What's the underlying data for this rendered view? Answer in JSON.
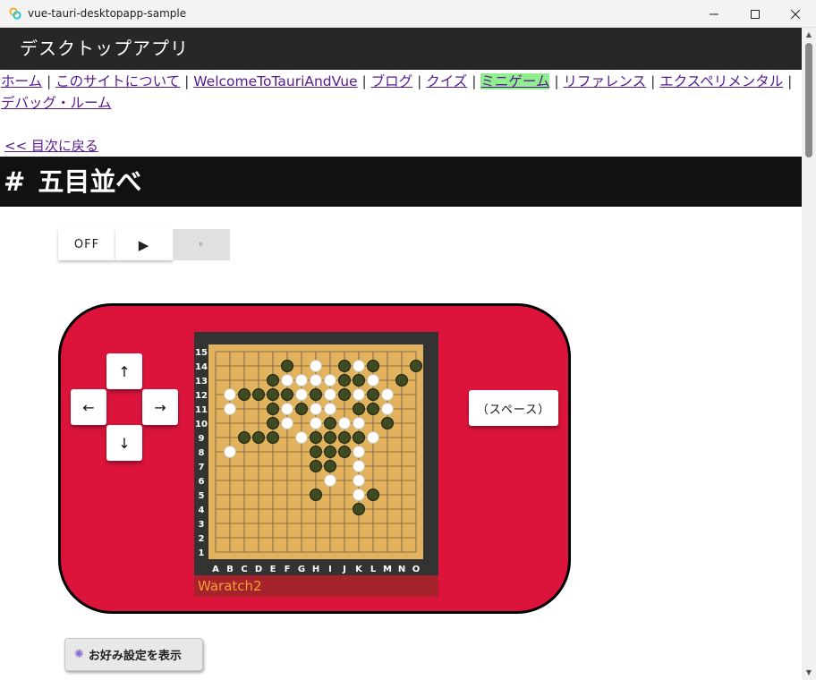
{
  "window": {
    "title": "vue-tauri-desktopapp-sample",
    "minimize_glyph": "—",
    "maximize_glyph": "☐",
    "close_glyph": "✕"
  },
  "header": {
    "title": "デスクトップアプリ"
  },
  "nav": {
    "items": [
      {
        "label": "ホーム",
        "active": false
      },
      {
        "label": "このサイトについて",
        "active": false
      },
      {
        "label": "WelcomeToTauriAndVue",
        "active": false
      },
      {
        "label": "ブログ",
        "active": false
      },
      {
        "label": "クイズ",
        "active": false
      },
      {
        "label": "ミニゲーム",
        "active": true
      },
      {
        "label": "リファレンス",
        "active": false
      },
      {
        "label": "エクスペリメンタル",
        "active": false
      },
      {
        "label": "デバッグ・ルーム",
        "active": false
      }
    ],
    "separator": " | "
  },
  "back_link": "<< 目次に戻る",
  "page_heading": {
    "hash": "#",
    "title": "五目並べ"
  },
  "toggle": {
    "off_label": "OFF",
    "play_label": "▶",
    "pause_label": "⏸",
    "selected": "play"
  },
  "controls": {
    "up": "↑",
    "left": "←",
    "right": "→",
    "down": "↓",
    "space": "（スペース）"
  },
  "board": {
    "columns": [
      "A",
      "B",
      "C",
      "D",
      "E",
      "F",
      "G",
      "H",
      "I",
      "J",
      "K",
      "L",
      "M",
      "N",
      "O"
    ],
    "rows": [
      "15",
      "14",
      "13",
      "12",
      "11",
      "10",
      "9",
      "8",
      "7",
      "6",
      "5",
      "4",
      "3",
      "2",
      "1"
    ],
    "player_name": "Waratch2",
    "colors": {
      "board": "#e2b25e",
      "frame": "#333333",
      "black_stone": "#3d4a22",
      "white_stone": "#ffffff",
      "name_bar": "#a7232c",
      "name_text": "#f0a030"
    },
    "black_stones": [
      "F14",
      "J14",
      "L14",
      "O14",
      "E13",
      "J13",
      "K13",
      "N13",
      "C12",
      "D12",
      "E12",
      "F12",
      "H12",
      "J12",
      "L12",
      "E11",
      "G11",
      "K11",
      "L11",
      "E10",
      "I10",
      "M10",
      "C9",
      "D9",
      "E9",
      "H9",
      "I9",
      "J9",
      "K9",
      "H8",
      "I8",
      "J8",
      "H7",
      "I7",
      "H5",
      "L5",
      "K4"
    ],
    "white_stones": [
      "H14",
      "K14",
      "F13",
      "G13",
      "H13",
      "I13",
      "L13",
      "B12",
      "G12",
      "I12",
      "K12",
      "M12",
      "B11",
      "F11",
      "H11",
      "I11",
      "M11",
      "F10",
      "H10",
      "J10",
      "K10",
      "G9",
      "L9",
      "B8",
      "K8",
      "K7",
      "I6",
      "K6",
      "K5"
    ]
  },
  "preferences_button": {
    "icon": "gear-icon",
    "label": "お好み設定を表示"
  },
  "accent_colors": {
    "console": "#dc143c",
    "active_nav": "#90ee90",
    "heading_bg": "#111111"
  }
}
